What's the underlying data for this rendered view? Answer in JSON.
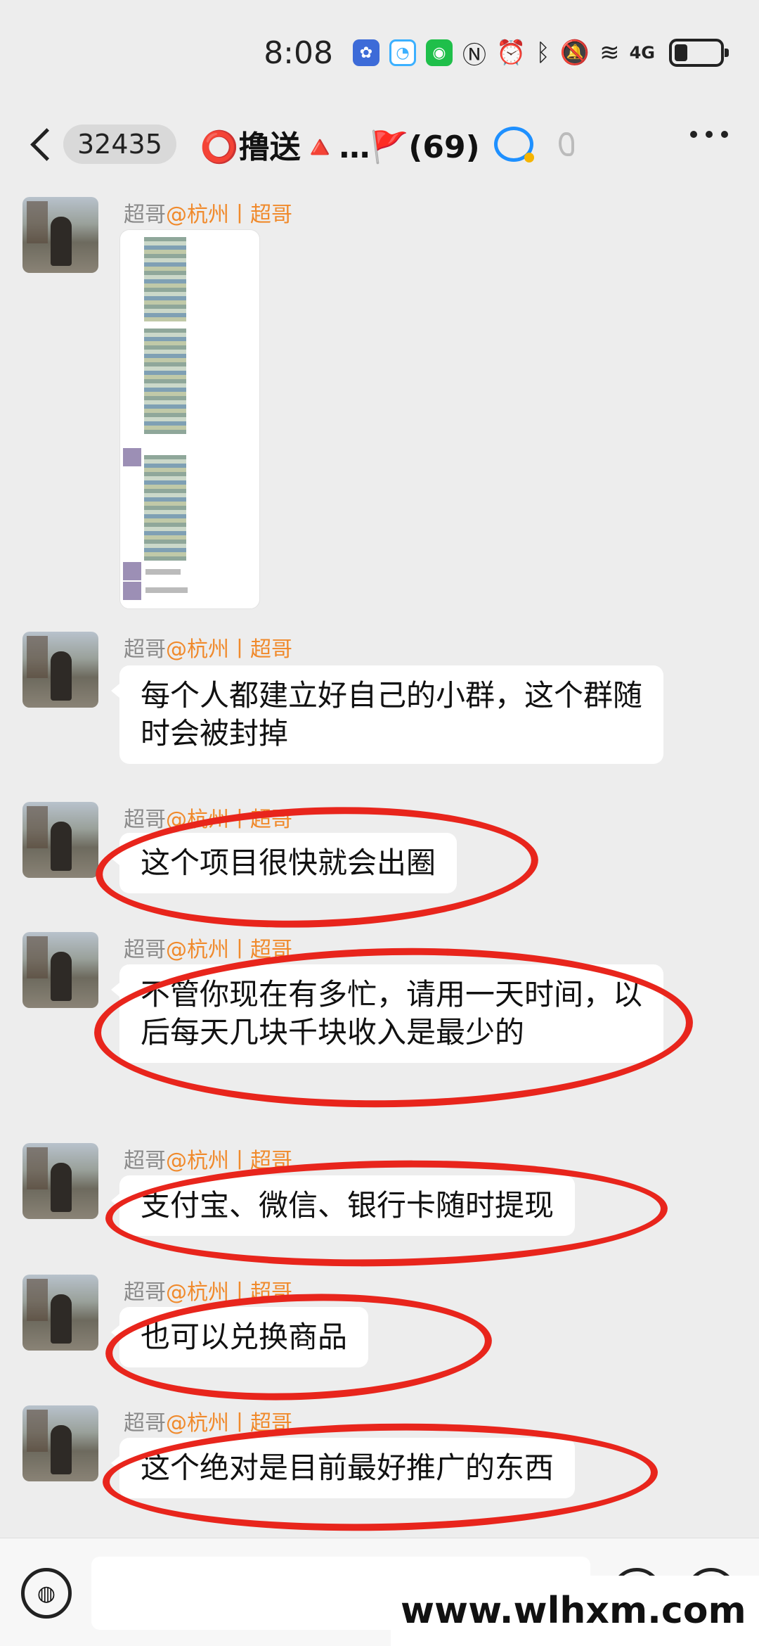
{
  "status_bar": {
    "time": "8:08",
    "network": "4G"
  },
  "header": {
    "unread_count": "32435",
    "title": "⭕撸送🔺…🚩(69)"
  },
  "sender": {
    "name": "超哥",
    "tag": "@杭州丨超哥"
  },
  "messages": [
    {
      "type": "image"
    },
    {
      "type": "text",
      "text": "每个人都建立好自己的小群，这个群随时会被封掉"
    },
    {
      "type": "text",
      "text": "这个项目很快就会出圈"
    },
    {
      "type": "text",
      "text": "不管你现在有多忙，请用一天时间，以后每天几块千块收入是最少的"
    },
    {
      "type": "text",
      "text": "支付宝、微信、银行卡随时提现"
    },
    {
      "type": "text",
      "text": "也可以兑换商品"
    },
    {
      "type": "text",
      "text": "这个绝对是目前最好推广的东西"
    }
  ],
  "input_bar": {
    "placeholder": ""
  },
  "watermark": "www.wlhxm.com",
  "colors": {
    "background": "#ededed",
    "name_gray": "#8a8a8a",
    "name_orange": "#f08a2c",
    "annotation_red": "#e8251c"
  }
}
